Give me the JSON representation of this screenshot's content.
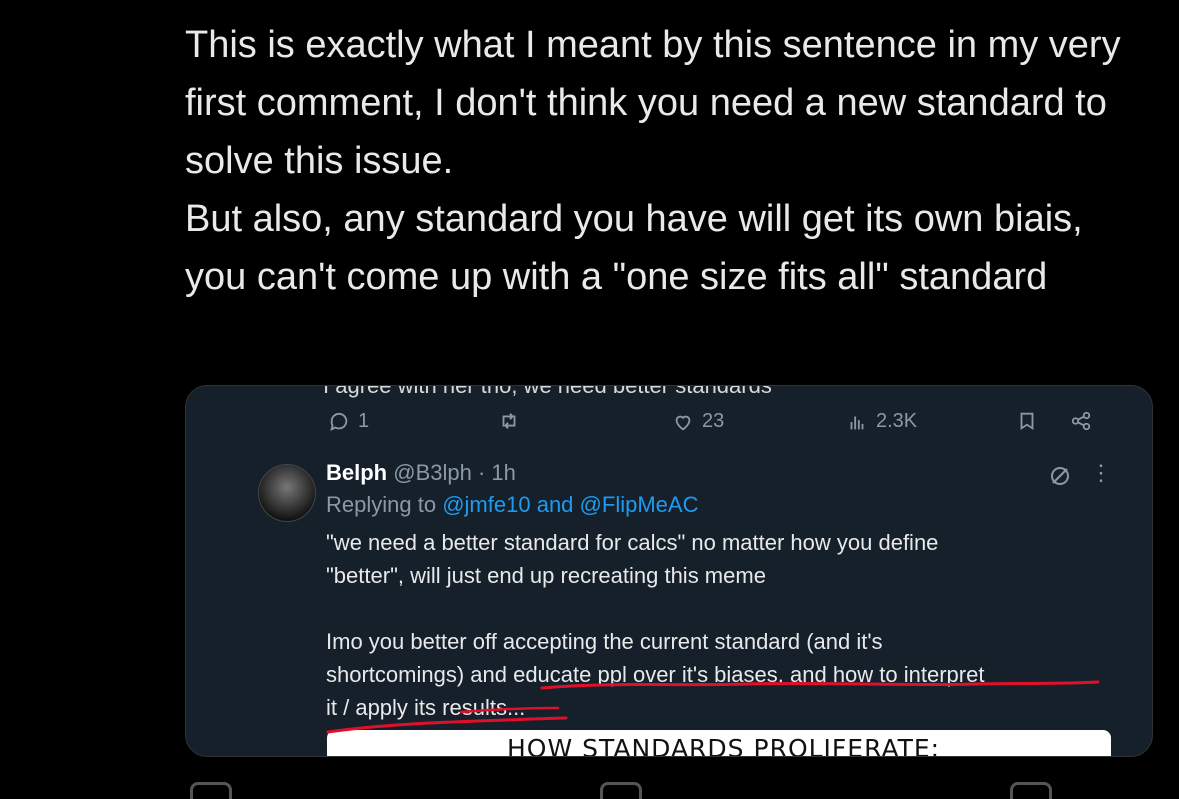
{
  "tweet": {
    "paragraphs": [
      "This is exactly what I meant by this sentence in my very first comment, I don't think you need a new standard to solve this issue.",
      "But also, any standard you have will get its own biais, you can't come up with a \"one size fits all\" standard"
    ]
  },
  "quote": {
    "cut_line": "I agree with her tho, we need better standards",
    "actions": {
      "replies": "1",
      "likes": "23",
      "views": "2.3K"
    },
    "reply": {
      "name": "Belph",
      "meta": "@B3lph · 1h",
      "replying_prefix": "Replying to",
      "mention1": "@jmfe10",
      "and": "and",
      "mention2": "@FlipMeAC",
      "line1": "\"we need a better standard for calcs\" no matter how you define",
      "line2": "\"better\", will just end up recreating this meme",
      "line3": "Imo you better off accepting the current standard (and it's",
      "line4": "shortcomings) and educate ppl over it's biases, and how to interpret",
      "line5": "it / apply its results..."
    },
    "comic_title": "HOW STANDARDS PROLIFERATE:"
  },
  "colors": {
    "background": "#000000",
    "card": "#15202b",
    "mention": "#1d9bf0",
    "underline": "#e0102a"
  },
  "icons": [
    "reply-icon",
    "retweet-icon",
    "like-icon",
    "views-icon",
    "bookmark-icon",
    "share-icon",
    "grok-icon",
    "more-icon"
  ]
}
